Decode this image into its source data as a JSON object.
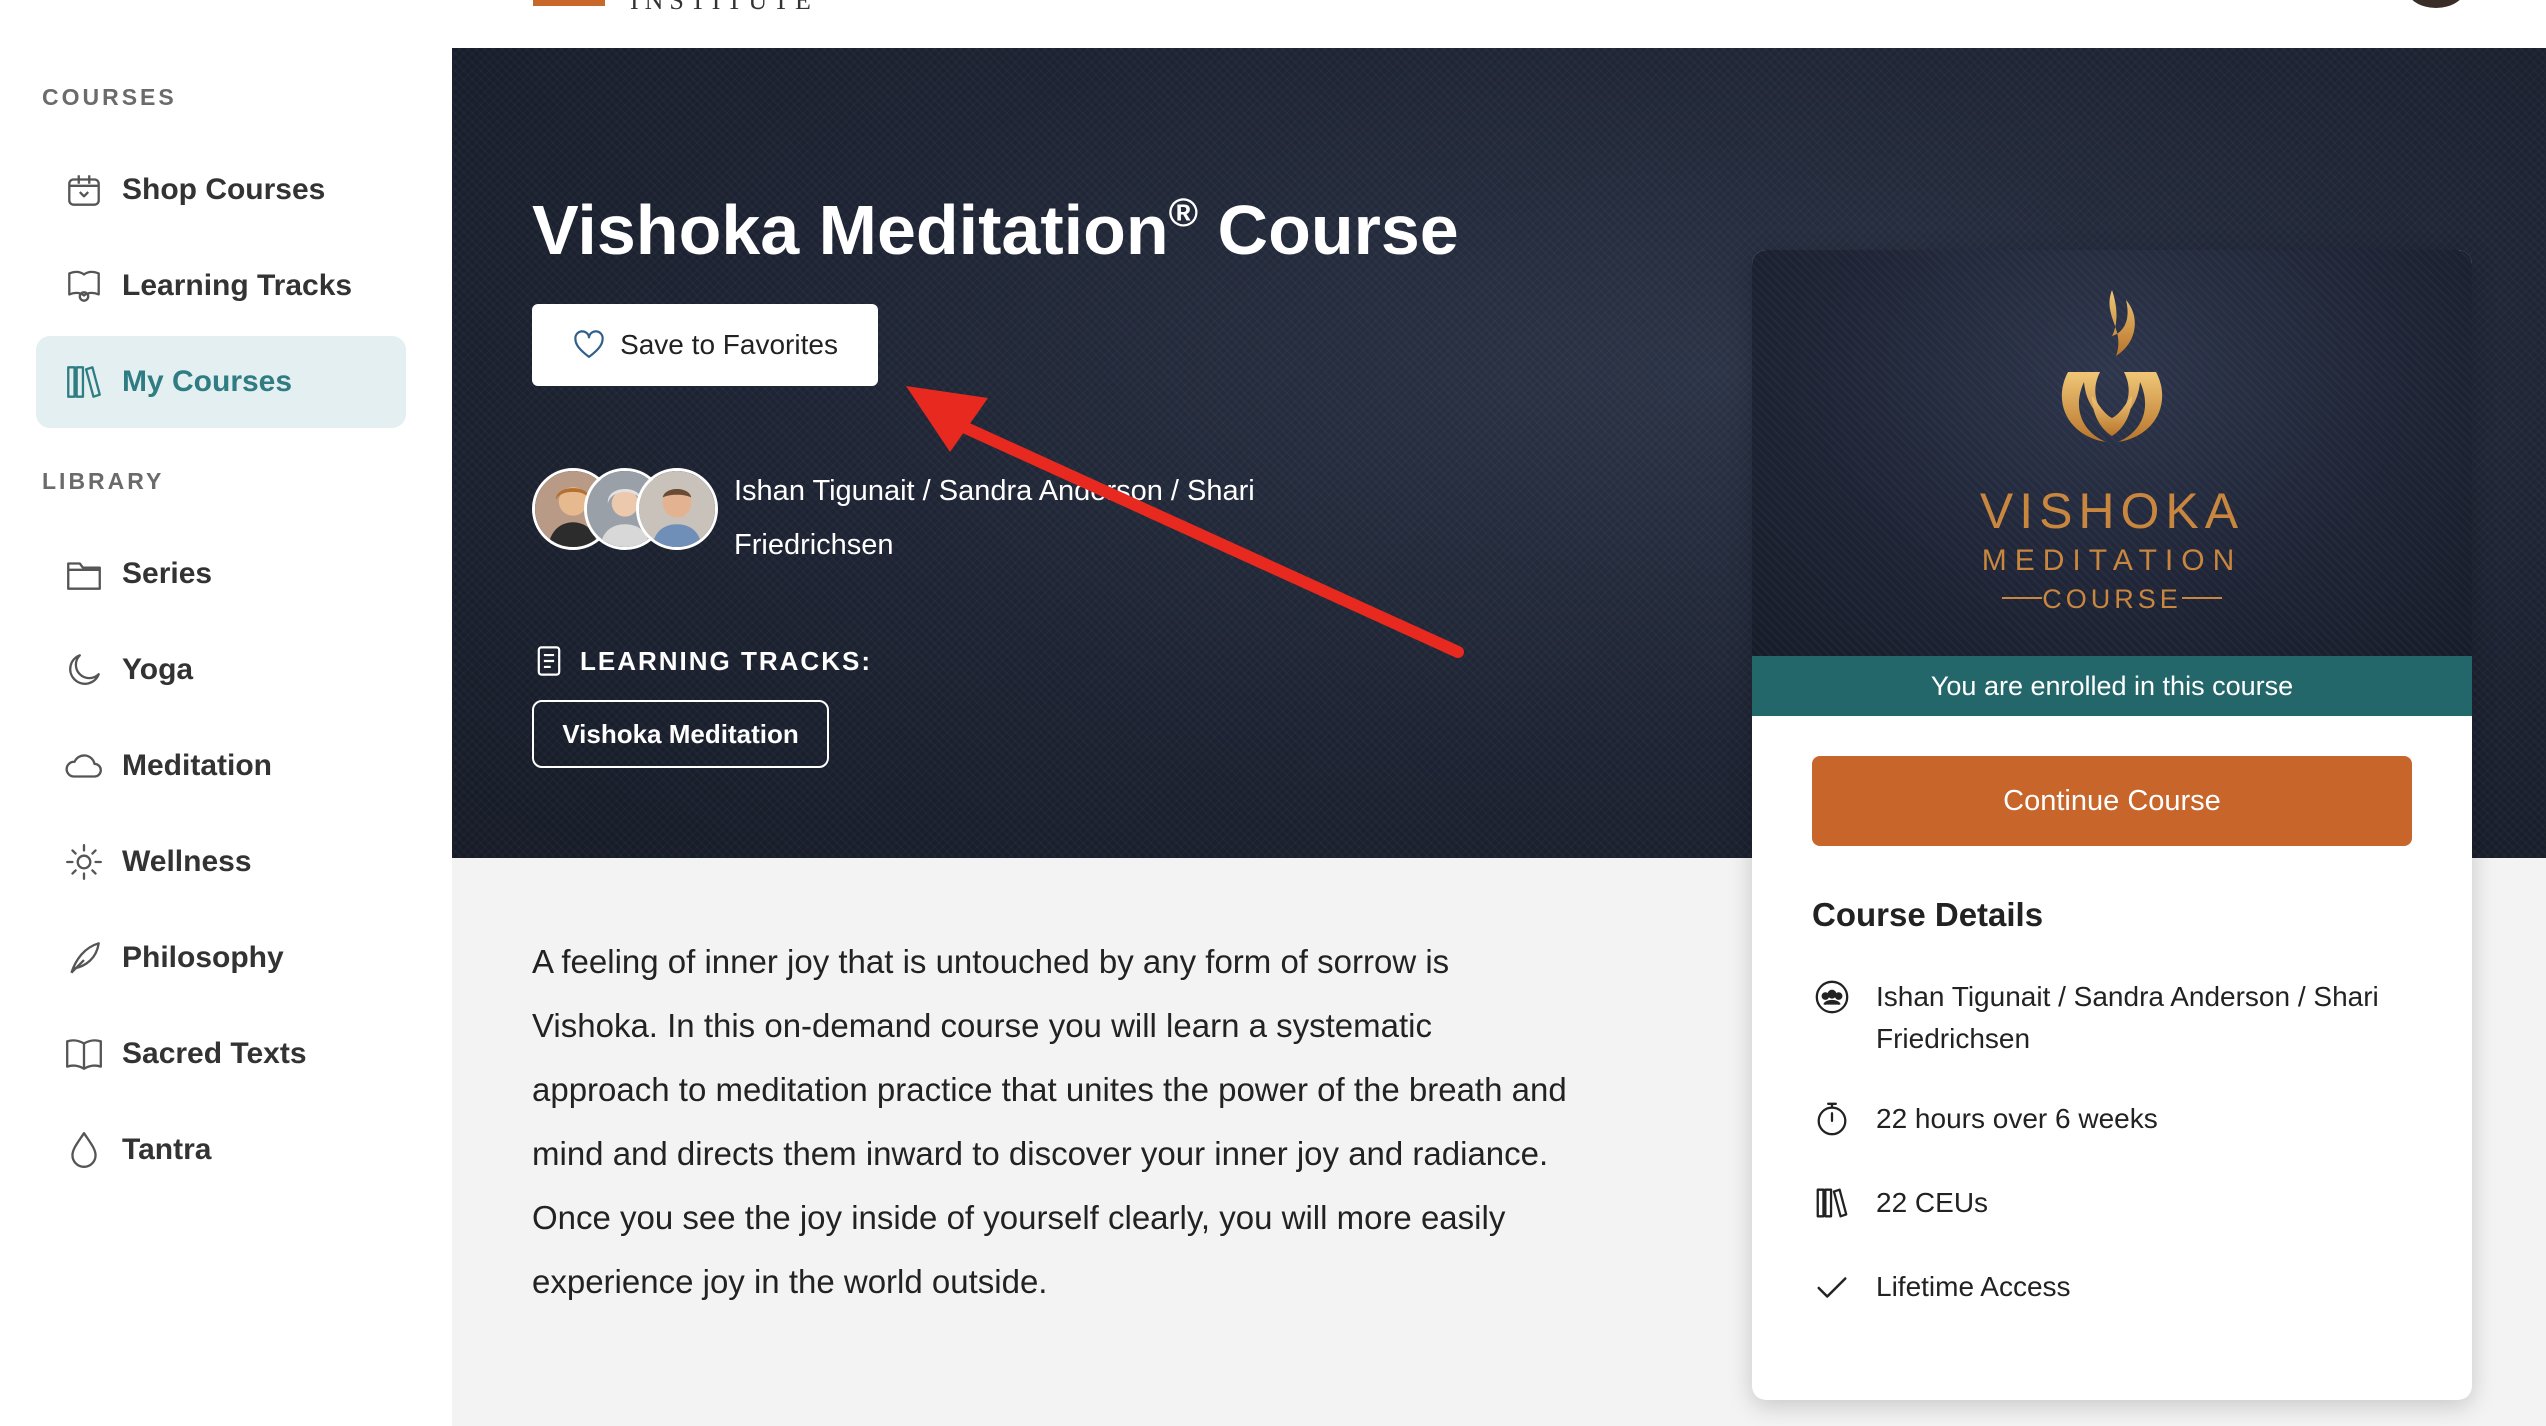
{
  "header": {
    "logo_text": "INSTITUTE"
  },
  "sidebar": {
    "courses_label": "COURSES",
    "library_label": "LIBRARY",
    "courses_items": [
      {
        "label": "Shop Courses",
        "icon": "shop-icon",
        "active": false
      },
      {
        "label": "Learning Tracks",
        "icon": "learning-tracks-icon",
        "active": false
      },
      {
        "label": "My Courses",
        "icon": "books-icon",
        "active": true
      }
    ],
    "library_items": [
      {
        "label": "Series",
        "icon": "folder-icon"
      },
      {
        "label": "Yoga",
        "icon": "moon-icon"
      },
      {
        "label": "Meditation",
        "icon": "cloud-icon"
      },
      {
        "label": "Wellness",
        "icon": "sun-icon"
      },
      {
        "label": "Philosophy",
        "icon": "feather-icon"
      },
      {
        "label": "Sacred Texts",
        "icon": "open-book-icon"
      },
      {
        "label": "Tantra",
        "icon": "drop-icon"
      }
    ]
  },
  "hero": {
    "title": "Vishoka Meditation",
    "title_mark": "®",
    "title_suffix": " Course",
    "favorite_label": "Save to Favorites",
    "authors_line1": "Ishan Tigunait / Sandra Anderson / Shari",
    "authors_line2": "Friedrichsen",
    "tracks_label": "LEARNING TRACKS:",
    "track_chip": "Vishoka Meditation"
  },
  "description": "A feeling of inner joy that is untouched by any form of sorrow is Vishoka. In this on-demand course you will learn a systematic approach to meditation practice that unites the power of the breath and mind and directs them inward to discover your inner joy and radiance. Once you see the joy inside of yourself clearly, you will more easily experience joy in the world outside.",
  "card": {
    "logo_line1": "VISHOKA",
    "logo_line2": "MEDITATION",
    "logo_line3": "COURSE",
    "enrolled_text": "You are enrolled in this course",
    "continue_label": "Continue Course",
    "details_title": "Course Details",
    "details": [
      {
        "icon": "people-icon",
        "text": "Ishan Tigunait / Sandra Anderson / Shari Friedrichsen"
      },
      {
        "icon": "stopwatch-icon",
        "text": "22 hours over 6 weeks"
      },
      {
        "icon": "books-icon",
        "text": "22 CEUs"
      },
      {
        "icon": "checkmark-icon",
        "text": "Lifetime Access"
      }
    ]
  },
  "colors": {
    "accent_teal": "#2f7d82",
    "enrolled_bar": "#24676b",
    "cta_orange": "#c7652a",
    "annotation_red": "#e8291f"
  }
}
